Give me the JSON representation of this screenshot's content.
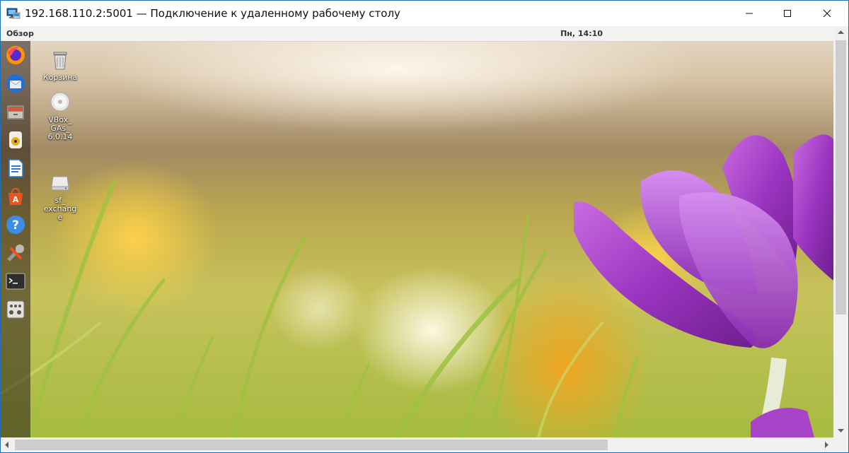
{
  "window": {
    "title": "192.168.110.2:5001 — Подключение к удаленному рабочему столу",
    "icon": "remote-desktop-icon",
    "controls": [
      "minimize-icon",
      "maximize-icon",
      "close-icon"
    ]
  },
  "top_bar": {
    "overview_label": "Обзор",
    "clock": "Пн, 14:10"
  },
  "dock": {
    "items": [
      {
        "name": "Firefox",
        "icon": "firefox-icon"
      },
      {
        "name": "Thunderbird",
        "icon": "thunderbird-icon"
      },
      {
        "name": "Files",
        "icon": "files-icon"
      },
      {
        "name": "Rhythmbox",
        "icon": "rhythmbox-icon"
      },
      {
        "name": "LibreOffice Writer",
        "icon": "writer-icon"
      },
      {
        "name": "Ubuntu Software",
        "icon": "software-icon"
      },
      {
        "name": "Help",
        "icon": "help-icon"
      },
      {
        "name": "Settings",
        "icon": "tools-icon"
      },
      {
        "name": "Terminal",
        "icon": "terminal-icon"
      },
      {
        "name": "Show Applications",
        "icon": "apps-icon"
      }
    ]
  },
  "desktop": {
    "icons": [
      {
        "label": "Корзина",
        "icon": "trash-icon"
      },
      {
        "label": "VBox_\nGAs_\n6.0.14",
        "icon": "cd-icon"
      },
      {
        "label": "sf_\nexchang\ne",
        "icon": "drive-icon"
      }
    ]
  },
  "colors": {
    "accent": "#1a6fb8",
    "flower": "#a23cc4",
    "grass": "#a7b93a"
  }
}
